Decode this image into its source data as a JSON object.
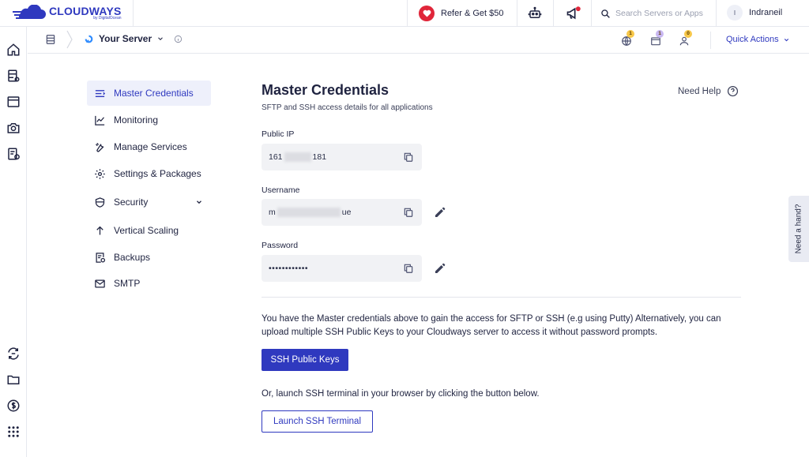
{
  "brand": {
    "name": "CLOUDWAYS",
    "sub": "by DigitalOcean"
  },
  "topbar": {
    "refer_label": "Refer & Get $50",
    "search_placeholder": "Search Servers or Apps",
    "user_initial": "I",
    "user_name": "Indraneil"
  },
  "subheader": {
    "server_name": "Your Server",
    "notif_counts": [
      "1",
      "1",
      "0"
    ],
    "quick_actions": "Quick Actions"
  },
  "sidenav": {
    "items": [
      {
        "label": "Master Credentials",
        "icon": "list-icon"
      },
      {
        "label": "Monitoring",
        "icon": "chart-line-icon"
      },
      {
        "label": "Manage Services",
        "icon": "wrench-icon"
      },
      {
        "label": "Settings & Packages",
        "icon": "gear-icon"
      },
      {
        "label": "Security",
        "icon": "shield-icon"
      },
      {
        "label": "Vertical Scaling",
        "icon": "arrow-up-icon"
      },
      {
        "label": "Backups",
        "icon": "backup-icon"
      },
      {
        "label": "SMTP",
        "icon": "mail-icon"
      }
    ]
  },
  "main": {
    "title": "Master Credentials",
    "subtitle": "SFTP and SSH access details for all applications",
    "help": "Need Help",
    "public_ip_label": "Public IP",
    "public_ip_start": "161",
    "public_ip_end": "181",
    "username_label": "Username",
    "username_start": "m",
    "username_end": "ue",
    "password_label": "Password",
    "password_value": "••••••••••••",
    "info": "You have the Master credentials above to gain the access for SFTP or SSH (e.g using Putty) Alternatively, you can upload multiple SSH Public Keys to your Cloudways server to access it without password prompts.",
    "ssh_keys_button": "SSH Public Keys",
    "or_launch": "Or, launch SSH terminal in your browser by clicking the button below.",
    "launch_button": "Launch SSH Terminal"
  },
  "need_hand": "Need a hand?",
  "colors": {
    "accent": "#2f39bf",
    "refer_red": "#e0263a",
    "badge_yellow": "#f7c84a",
    "badge_purple": "#c9b8f2"
  }
}
